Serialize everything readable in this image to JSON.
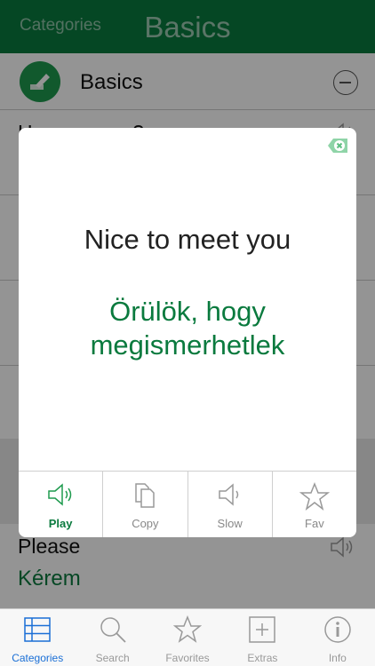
{
  "header": {
    "back_label": "Categories",
    "title": "Basics"
  },
  "category": {
    "label": "Basics"
  },
  "list": {
    "rows": [
      {
        "en": "How are you?",
        "hu": ""
      },
      {
        "en": "",
        "hu": ""
      },
      {
        "en": "",
        "hu": ""
      },
      {
        "en": "",
        "hu": ""
      },
      {
        "en": "",
        "hu": ""
      },
      {
        "en": "Please",
        "hu": "Kérem"
      }
    ]
  },
  "modal": {
    "english": "Nice to meet you",
    "hungarian": "Örülök, hogy megismerhetlek",
    "actions": [
      {
        "label": "Play",
        "icon": "speaker-icon"
      },
      {
        "label": "Copy",
        "icon": "copy-icon"
      },
      {
        "label": "Slow",
        "icon": "speaker-icon"
      },
      {
        "label": "Fav",
        "icon": "star-icon"
      }
    ]
  },
  "tabs": [
    {
      "label": "Categories",
      "icon": "list-icon"
    },
    {
      "label": "Search",
      "icon": "search-icon"
    },
    {
      "label": "Favorites",
      "icon": "star-icon"
    },
    {
      "label": "Extras",
      "icon": "plus-icon"
    },
    {
      "label": "Info",
      "icon": "info-icon"
    }
  ],
  "colors": {
    "brand_green": "#0a7a3e",
    "tab_active": "#1a6fd6"
  }
}
